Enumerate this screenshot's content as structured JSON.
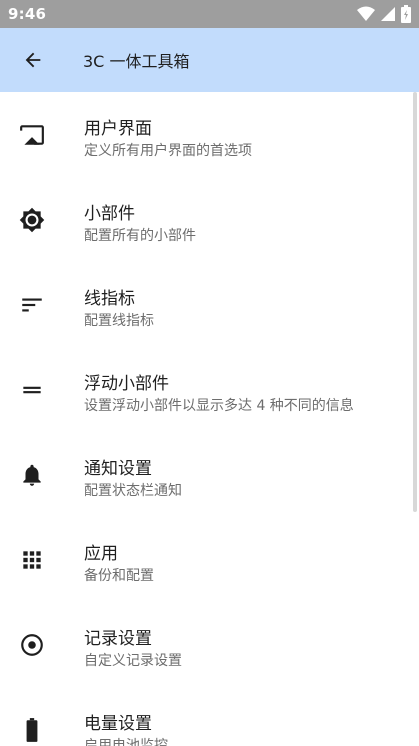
{
  "status": {
    "time": "9:46"
  },
  "app_bar": {
    "title": "3C 一体工具箱"
  },
  "items": [
    {
      "title": "用户界面",
      "subtitle": "定义所有用户界面的首选项",
      "icon": "cast-icon"
    },
    {
      "title": "小部件",
      "subtitle": "配置所有的小部件",
      "icon": "brightness-icon"
    },
    {
      "title": "线指标",
      "subtitle": "配置线指标",
      "icon": "sort-lines-icon"
    },
    {
      "title": "浮动小部件",
      "subtitle": "设置浮动小部件以显示多达 4 种不同的信息",
      "icon": "equals-icon"
    },
    {
      "title": "通知设置",
      "subtitle": "配置状态栏通知",
      "icon": "bell-icon"
    },
    {
      "title": "应用",
      "subtitle": "备份和配置",
      "icon": "apps-grid-icon"
    },
    {
      "title": "记录设置",
      "subtitle": "自定义记录设置",
      "icon": "record-icon"
    },
    {
      "title": "电量设置",
      "subtitle": "启用电池监控",
      "icon": "battery-icon"
    }
  ]
}
